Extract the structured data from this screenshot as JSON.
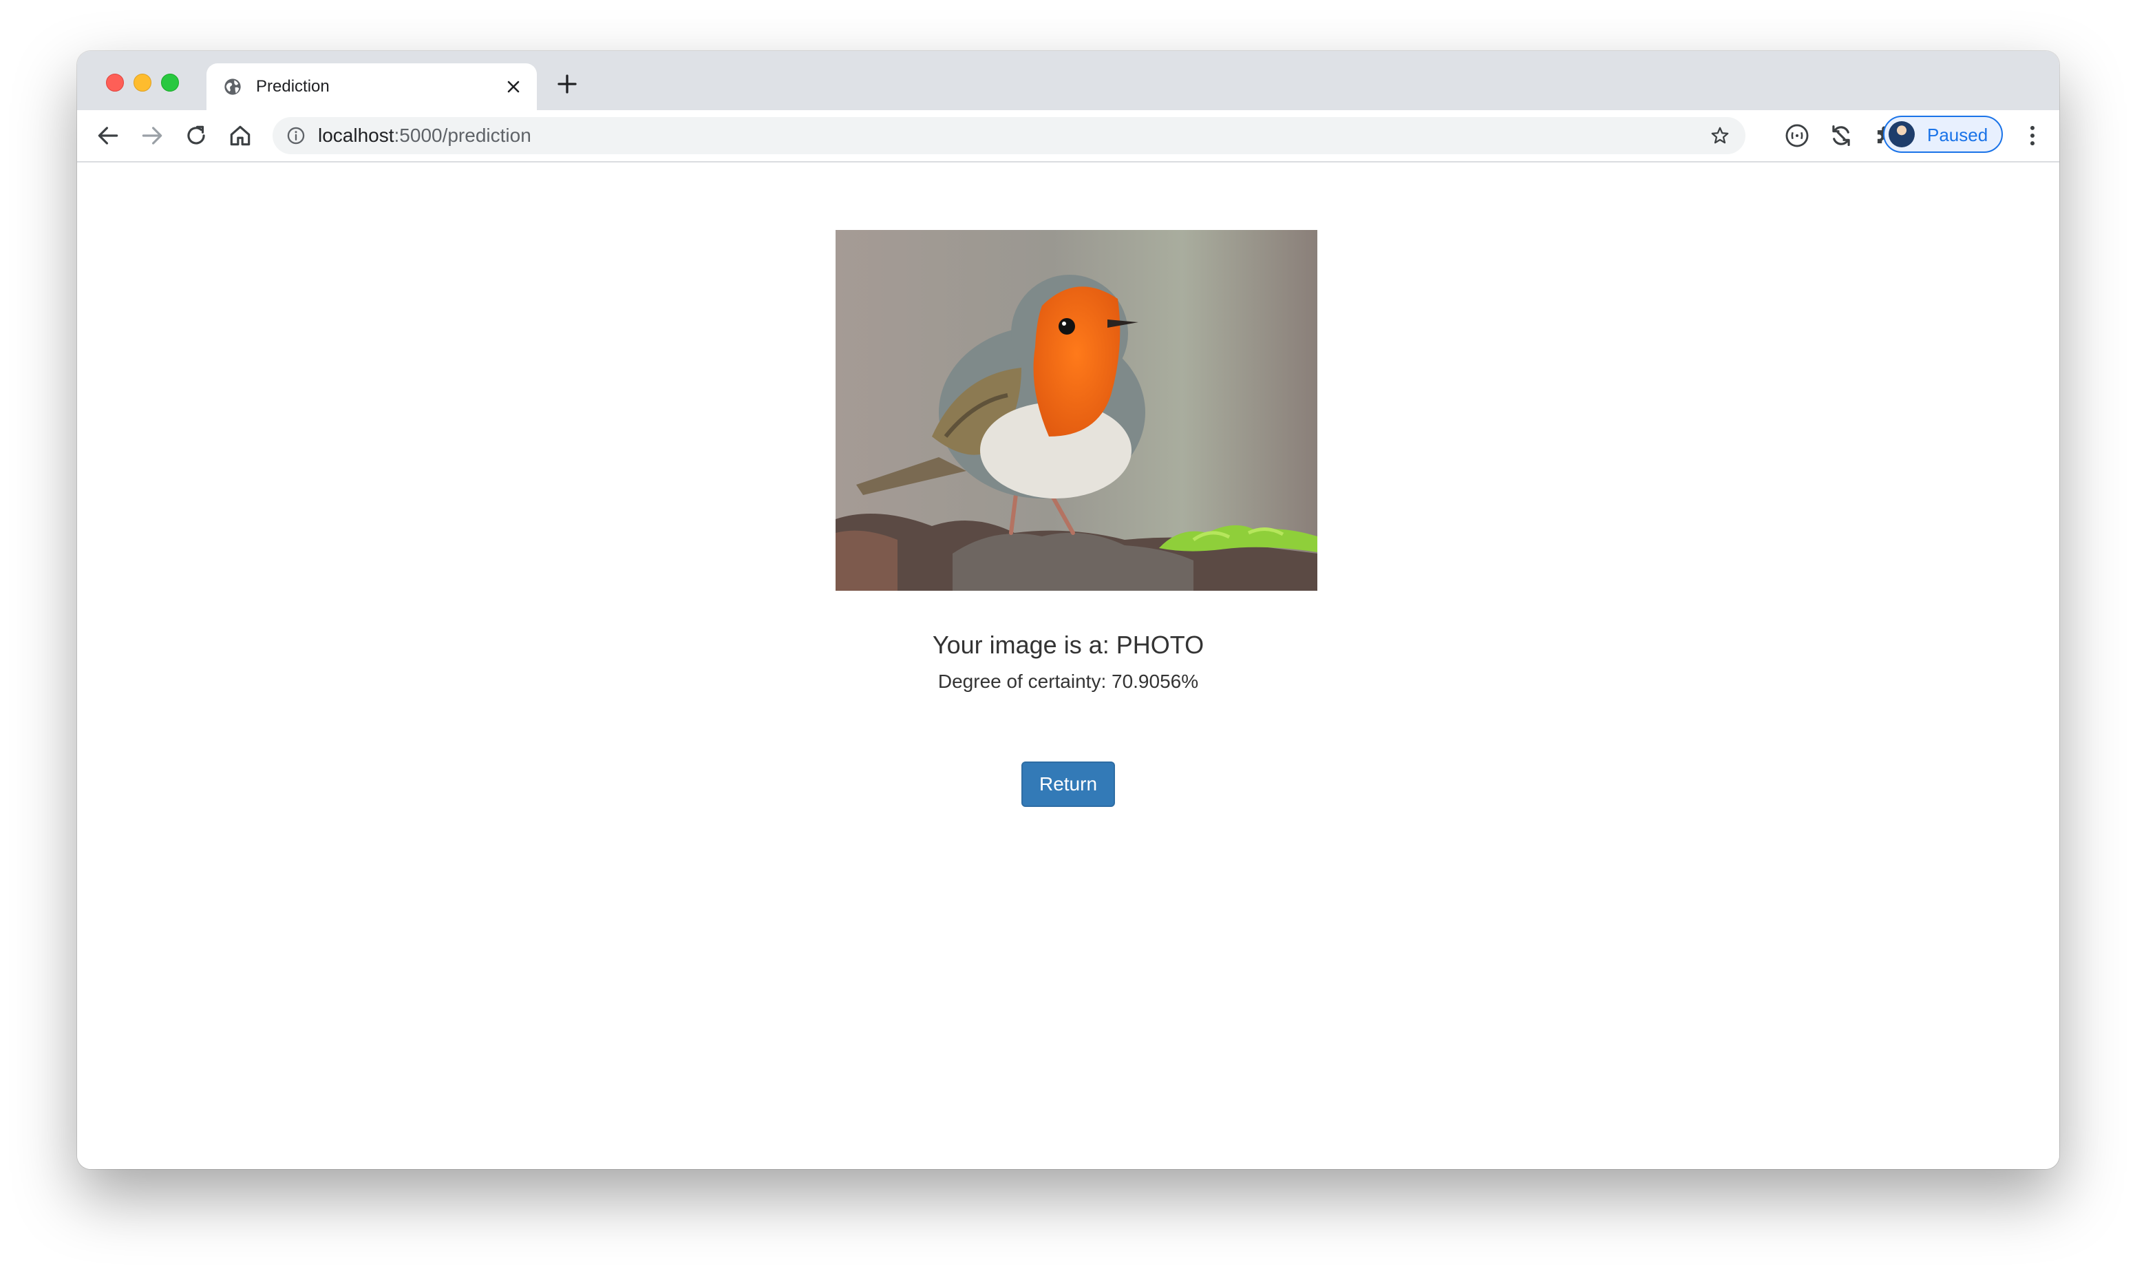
{
  "browser": {
    "tab": {
      "title": "Prediction",
      "favicon": "globe-icon",
      "close_icon": "close-icon"
    },
    "new_tab_icon": "plus-icon",
    "toolbar": {
      "back_icon": "arrow-left-icon",
      "forward_icon": "arrow-right-icon",
      "reload_icon": "reload-icon",
      "home_icon": "home-icon",
      "address": {
        "host": "localhost",
        "rest": ":5000/prediction",
        "info_icon": "info-icon",
        "bookmark_icon": "star-icon"
      },
      "extensions": [
        "extension-circle-icon",
        "sync-icon",
        "puzzle-icon"
      ],
      "profile": {
        "label": "Paused"
      },
      "menu_icon": "kebab-menu-icon"
    }
  },
  "page": {
    "image_subject": "robin bird perched on branch",
    "result_heading": "Your image is a: PHOTO",
    "certainty": "Degree of certainty: 70.9056%",
    "return_label": "Return"
  },
  "colors": {
    "button": "#337ab7",
    "text": "#333333",
    "profile_accent": "#1a73e8"
  }
}
